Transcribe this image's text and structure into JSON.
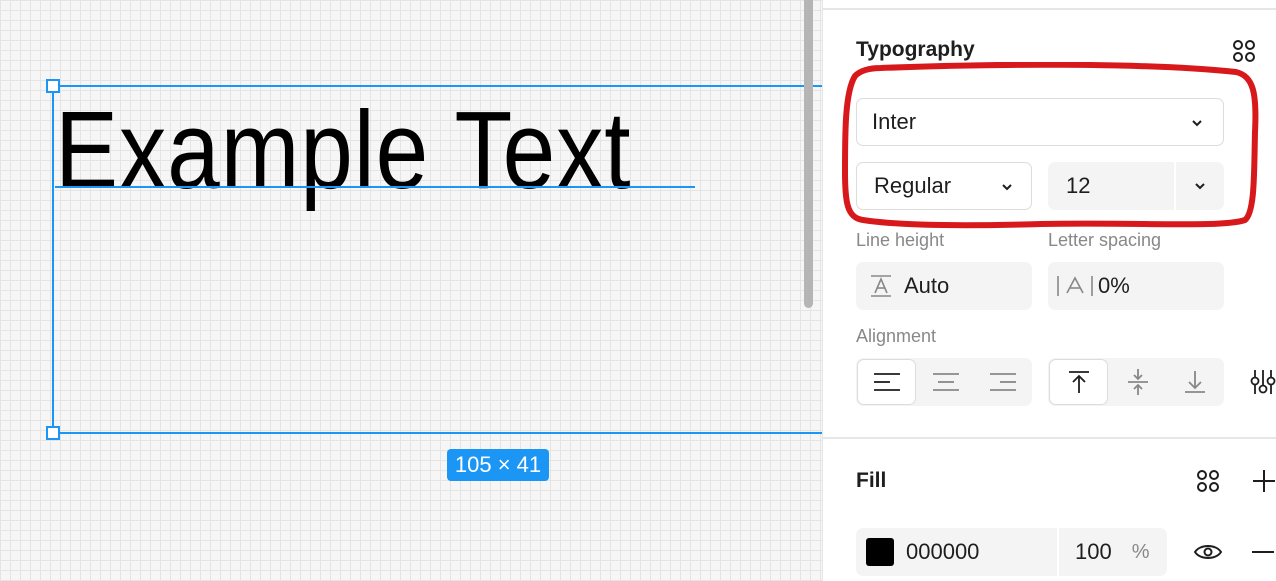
{
  "canvas": {
    "text_content": "Example Text",
    "size_badge": "105 × 41"
  },
  "typography": {
    "title": "Typography",
    "font_family": "Inter",
    "font_style": "Regular",
    "font_size": "12",
    "line_height_label": "Line height",
    "line_height_value": "Auto",
    "letter_spacing_label": "Letter spacing",
    "letter_spacing_value": "0%",
    "alignment_label": "Alignment",
    "horizontal_align_selected": "left",
    "vertical_align_selected": "top"
  },
  "fill": {
    "title": "Fill",
    "color_hex": "000000",
    "opacity": "100",
    "opacity_unit": "%"
  },
  "colors": {
    "selection": "#1b96f5",
    "annotation": "#d8191c",
    "fill_swatch": "#000000"
  },
  "icons": {
    "styles": "styles-grid-icon",
    "dropdown": "chevron-down-icon",
    "line_height": "line-height-icon",
    "letter_spacing": "letter-spacing-icon",
    "type_settings": "sliders-icon",
    "add": "plus-icon",
    "visibility": "eye-icon",
    "remove": "minus-icon"
  }
}
